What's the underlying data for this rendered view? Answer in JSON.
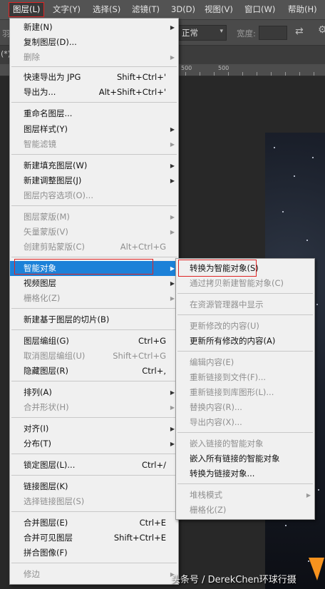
{
  "menubar": {
    "items": [
      {
        "label": "图层(L)"
      },
      {
        "label": "文字(Y)"
      },
      {
        "label": "选择(S)"
      },
      {
        "label": "滤镜(T)"
      },
      {
        "label": "3D(D)"
      },
      {
        "label": "视图(V)"
      },
      {
        "label": "窗口(W)"
      },
      {
        "label": "帮助(H)"
      }
    ]
  },
  "options_bar": {
    "blend_mode_value": "正常",
    "width_label": "宽度:",
    "left_partial": "羽",
    "tab_partial": "(*)"
  },
  "ruler": {
    "label_500a": "500",
    "label_500b": "500"
  },
  "layer_menu": {
    "items": [
      {
        "label": "新建(N)",
        "has_submenu": true
      },
      {
        "label": "复制图层(D)..."
      },
      {
        "label": "删除",
        "disabled": true,
        "has_submenu": true
      },
      {
        "label": "快速导出为 JPG",
        "shortcut": "Shift+Ctrl+'"
      },
      {
        "label": "导出为...",
        "shortcut": "Alt+Shift+Ctrl+'"
      },
      {
        "label": "重命名图层..."
      },
      {
        "label": "图层样式(Y)",
        "has_submenu": true
      },
      {
        "label": "智能滤镜",
        "disabled": true,
        "has_submenu": true
      },
      {
        "label": "新建填充图层(W)",
        "has_submenu": true
      },
      {
        "label": "新建调整图层(J)",
        "has_submenu": true
      },
      {
        "label": "图层内容选项(O)...",
        "disabled": true
      },
      {
        "label": "图层蒙版(M)",
        "disabled": true,
        "has_submenu": true
      },
      {
        "label": "矢量蒙版(V)",
        "disabled": true,
        "has_submenu": true
      },
      {
        "label": "创建剪贴蒙版(C)",
        "disabled": true,
        "shortcut": "Alt+Ctrl+G"
      },
      {
        "label": "智能对象",
        "has_submenu": true,
        "highlighted": true
      },
      {
        "label": "视频图层",
        "has_submenu": true
      },
      {
        "label": "栅格化(Z)",
        "disabled": true,
        "has_submenu": true
      },
      {
        "label": "新建基于图层的切片(B)"
      },
      {
        "label": "图层编组(G)",
        "shortcut": "Ctrl+G"
      },
      {
        "label": "取消图层编组(U)",
        "disabled": true,
        "shortcut": "Shift+Ctrl+G"
      },
      {
        "label": "隐藏图层(R)",
        "shortcut": "Ctrl+,"
      },
      {
        "label": "排列(A)",
        "has_submenu": true
      },
      {
        "label": "合并形状(H)",
        "disabled": true,
        "has_submenu": true
      },
      {
        "label": "对齐(I)",
        "has_submenu": true
      },
      {
        "label": "分布(T)",
        "has_submenu": true
      },
      {
        "label": "锁定图层(L)...",
        "shortcut": "Ctrl+/"
      },
      {
        "label": "链接图层(K)"
      },
      {
        "label": "选择链接图层(S)",
        "disabled": true
      },
      {
        "label": "合并图层(E)",
        "shortcut": "Ctrl+E"
      },
      {
        "label": "合并可见图层",
        "shortcut": "Shift+Ctrl+E"
      },
      {
        "label": "拼合图像(F)"
      },
      {
        "label": "修边",
        "disabled": true,
        "has_submenu": true
      }
    ]
  },
  "smart_object_menu": {
    "items": [
      {
        "label": "转换为智能对象(S)"
      },
      {
        "label": "通过拷贝新建智能对象(C)",
        "disabled": true
      },
      {
        "label": "在资源管理器中显示",
        "disabled": true
      },
      {
        "label": "更新修改的内容(U)",
        "disabled": true
      },
      {
        "label": "更新所有修改的内容(A)"
      },
      {
        "label": "编辑内容(E)",
        "disabled": true
      },
      {
        "label": "重新链接到文件(F)...",
        "disabled": true
      },
      {
        "label": "重新链接到库图形(L)...",
        "disabled": true
      },
      {
        "label": "替换内容(R)...",
        "disabled": true
      },
      {
        "label": "导出内容(X)...",
        "disabled": true
      },
      {
        "label": "嵌入链接的智能对象",
        "disabled": true
      },
      {
        "label": "嵌入所有链接的智能对象"
      },
      {
        "label": "转换为链接对象..."
      },
      {
        "label": "堆栈模式",
        "disabled": true,
        "has_submenu": true
      },
      {
        "label": "栅格化(Z)",
        "disabled": true
      }
    ]
  },
  "watermark": "头条号 / DerekChen环球行摄"
}
